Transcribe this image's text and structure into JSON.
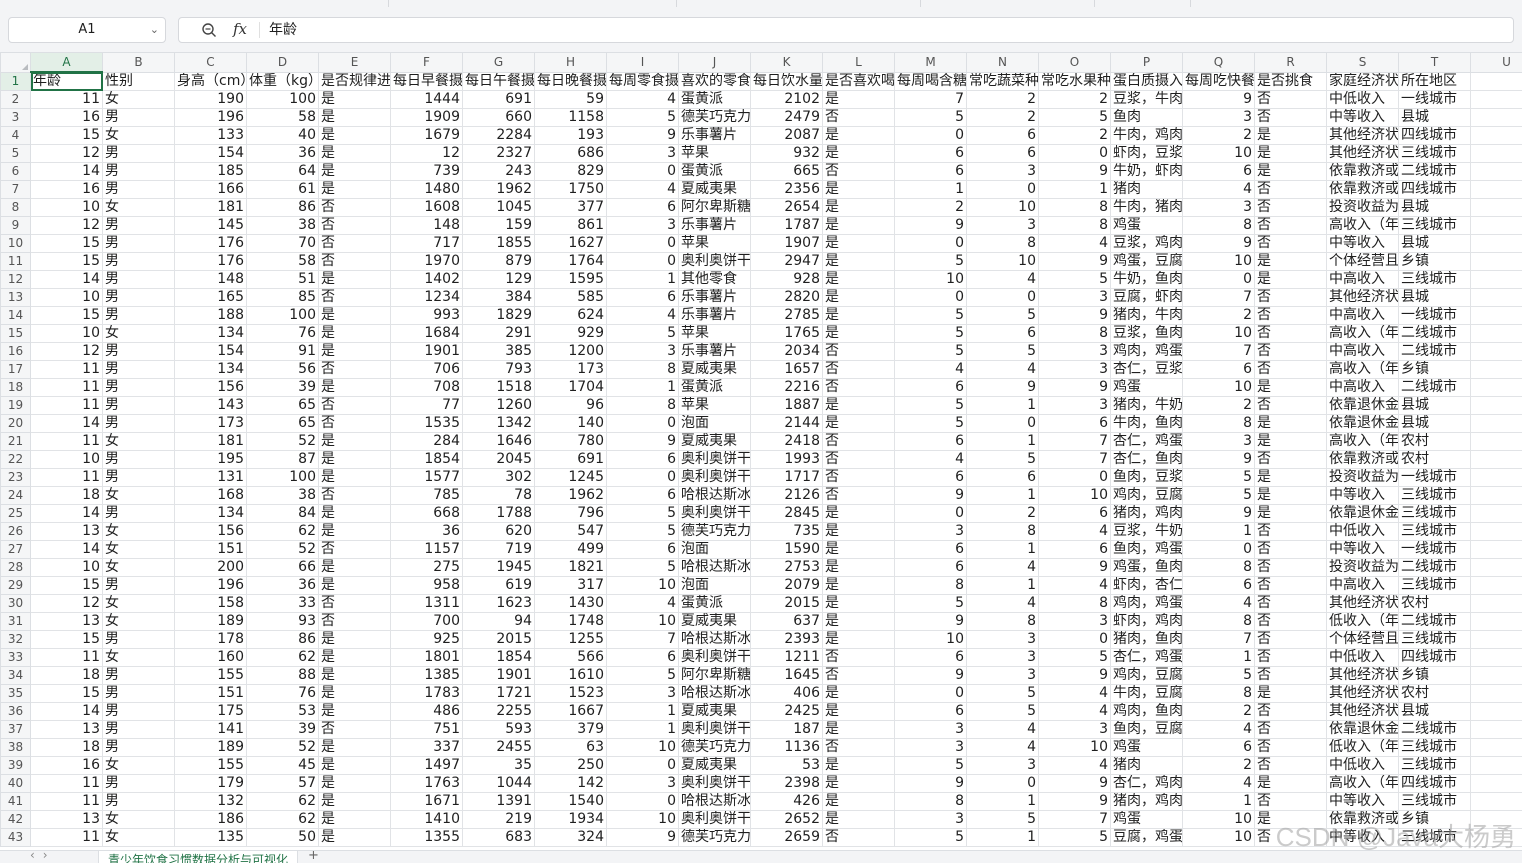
{
  "formula_bar": {
    "cell_ref": "A1",
    "value": "年龄"
  },
  "columns": [
    "A",
    "B",
    "C",
    "D",
    "E",
    "F",
    "G",
    "H",
    "I",
    "J",
    "K",
    "L",
    "M",
    "N",
    "O",
    "P",
    "Q",
    "R",
    "S",
    "T",
    "U"
  ],
  "rows": [
    [
      "年龄",
      "性别",
      "身高（cm）",
      "体重（kg）",
      "是否规律进",
      "每日早餐摄",
      "每日午餐摄",
      "每日晚餐摄",
      "每周零食摄",
      "喜欢的零食",
      "每日饮水量",
      "是否喜欢喝",
      "每周喝含糖",
      "常吃蔬菜种",
      "常吃水果种",
      "蛋白质摄入",
      "每周吃快餐",
      "是否挑食",
      "家庭经济状",
      "所在地区"
    ],
    [
      "11",
      "女",
      "190",
      "100",
      "是",
      "1444",
      "691",
      "59",
      "4",
      "蛋黄派",
      "2102",
      "是",
      "7",
      "2",
      "2",
      "豆浆，牛肉",
      "9",
      "否",
      "中低收入",
      "一线城市"
    ],
    [
      "16",
      "男",
      "196",
      "58",
      "是",
      "1909",
      "660",
      "1158",
      "5",
      "德芙巧克力",
      "2479",
      "否",
      "5",
      "2",
      "5",
      "鱼肉",
      "3",
      "否",
      "中等收入",
      "县城"
    ],
    [
      "15",
      "女",
      "133",
      "40",
      "是",
      "1679",
      "2284",
      "193",
      "9",
      "乐事薯片",
      "2087",
      "是",
      "0",
      "6",
      "2",
      "牛肉，鸡肉",
      "2",
      "是",
      "其他经济状",
      "四线城市"
    ],
    [
      "12",
      "男",
      "154",
      "36",
      "是",
      "12",
      "2327",
      "686",
      "3",
      "苹果",
      "932",
      "是",
      "6",
      "6",
      "0",
      "虾肉，豆浆",
      "10",
      "是",
      "其他经济状",
      "三线城市"
    ],
    [
      "14",
      "男",
      "185",
      "64",
      "是",
      "739",
      "243",
      "829",
      "0",
      "蛋黄派",
      "665",
      "否",
      "6",
      "3",
      "9",
      "牛奶，虾肉",
      "6",
      "是",
      "依靠救济或",
      "二线城市"
    ],
    [
      "16",
      "男",
      "166",
      "61",
      "是",
      "1480",
      "1962",
      "1750",
      "4",
      "夏威夷果",
      "2356",
      "是",
      "1",
      "0",
      "1",
      "猪肉",
      "4",
      "否",
      "依靠救济或",
      "四线城市"
    ],
    [
      "10",
      "女",
      "181",
      "86",
      "否",
      "1608",
      "1045",
      "377",
      "6",
      "阿尔卑斯糖",
      "2654",
      "是",
      "2",
      "10",
      "8",
      "牛肉，猪肉",
      "3",
      "否",
      "投资收益为",
      "县城"
    ],
    [
      "12",
      "男",
      "145",
      "38",
      "否",
      "148",
      "159",
      "861",
      "3",
      "乐事薯片",
      "1787",
      "是",
      "9",
      "3",
      "8",
      "鸡蛋",
      "8",
      "否",
      "高收入（年",
      "三线城市"
    ],
    [
      "15",
      "男",
      "176",
      "70",
      "否",
      "717",
      "1855",
      "1627",
      "0",
      "苹果",
      "1907",
      "是",
      "0",
      "8",
      "4",
      "豆浆，鸡肉",
      "9",
      "否",
      "中等收入",
      "县城"
    ],
    [
      "15",
      "男",
      "176",
      "58",
      "否",
      "1970",
      "879",
      "1764",
      "0",
      "奥利奥饼干",
      "2947",
      "是",
      "5",
      "10",
      "9",
      "鸡蛋，豆腐",
      "10",
      "是",
      "个体经营且",
      "乡镇"
    ],
    [
      "14",
      "男",
      "148",
      "51",
      "是",
      "1402",
      "129",
      "1595",
      "1",
      "其他零食",
      "928",
      "是",
      "10",
      "4",
      "5",
      "牛奶，鱼肉",
      "0",
      "是",
      "中高收入",
      "三线城市"
    ],
    [
      "10",
      "男",
      "165",
      "85",
      "否",
      "1234",
      "384",
      "585",
      "6",
      "乐事薯片",
      "2820",
      "是",
      "0",
      "0",
      "3",
      "豆腐，虾肉",
      "7",
      "否",
      "其他经济状",
      "县城"
    ],
    [
      "15",
      "男",
      "188",
      "100",
      "是",
      "993",
      "1829",
      "624",
      "4",
      "乐事薯片",
      "2785",
      "是",
      "5",
      "5",
      "9",
      "猪肉，牛肉",
      "2",
      "否",
      "中高收入",
      "一线城市"
    ],
    [
      "10",
      "女",
      "134",
      "76",
      "是",
      "1684",
      "291",
      "929",
      "5",
      "苹果",
      "1765",
      "是",
      "5",
      "6",
      "8",
      "豆浆，鱼肉",
      "10",
      "否",
      "高收入（年",
      "二线城市"
    ],
    [
      "12",
      "男",
      "154",
      "91",
      "是",
      "1901",
      "385",
      "1200",
      "3",
      "乐事薯片",
      "2034",
      "否",
      "5",
      "5",
      "3",
      "鸡肉，鸡蛋",
      "7",
      "否",
      "中高收入",
      "二线城市"
    ],
    [
      "11",
      "男",
      "134",
      "56",
      "否",
      "706",
      "793",
      "173",
      "8",
      "夏威夷果",
      "1657",
      "否",
      "4",
      "4",
      "3",
      "杏仁，豆浆",
      "6",
      "否",
      "高收入（年",
      "乡镇"
    ],
    [
      "11",
      "男",
      "156",
      "39",
      "是",
      "708",
      "1518",
      "1704",
      "1",
      "蛋黄派",
      "2216",
      "否",
      "6",
      "9",
      "9",
      "鸡蛋",
      "10",
      "是",
      "中高收入",
      "二线城市"
    ],
    [
      "11",
      "男",
      "143",
      "65",
      "否",
      "77",
      "1260",
      "96",
      "8",
      "苹果",
      "1887",
      "是",
      "5",
      "1",
      "3",
      "猪肉，牛奶",
      "2",
      "否",
      "依靠退休金",
      "县城"
    ],
    [
      "14",
      "男",
      "173",
      "65",
      "否",
      "1535",
      "1342",
      "140",
      "0",
      "泡面",
      "2144",
      "是",
      "5",
      "0",
      "6",
      "牛肉，鱼肉",
      "8",
      "是",
      "依靠退休金",
      "县城"
    ],
    [
      "11",
      "女",
      "181",
      "52",
      "是",
      "284",
      "1646",
      "780",
      "9",
      "夏威夷果",
      "2418",
      "否",
      "6",
      "1",
      "7",
      "杏仁，鸡蛋",
      "3",
      "是",
      "高收入（年",
      "农村"
    ],
    [
      "10",
      "男",
      "195",
      "87",
      "是",
      "1854",
      "2045",
      "691",
      "6",
      "奥利奥饼干",
      "1993",
      "否",
      "4",
      "5",
      "7",
      "杏仁，鱼肉",
      "9",
      "否",
      "依靠救济或",
      "农村"
    ],
    [
      "11",
      "男",
      "131",
      "100",
      "是",
      "1577",
      "302",
      "1245",
      "0",
      "奥利奥饼干",
      "1717",
      "否",
      "6",
      "6",
      "0",
      "鱼肉，豆浆",
      "5",
      "是",
      "投资收益为",
      "一线城市"
    ],
    [
      "18",
      "女",
      "168",
      "38",
      "否",
      "785",
      "78",
      "1962",
      "6",
      "哈根达斯冰",
      "2126",
      "否",
      "9",
      "1",
      "10",
      "鸡肉，豆腐",
      "5",
      "是",
      "中等收入",
      "三线城市"
    ],
    [
      "14",
      "男",
      "134",
      "84",
      "是",
      "668",
      "1788",
      "796",
      "5",
      "奥利奥饼干",
      "2845",
      "是",
      "0",
      "2",
      "6",
      "猪肉，鸡肉",
      "9",
      "是",
      "依靠退休金",
      "三线城市"
    ],
    [
      "13",
      "女",
      "156",
      "62",
      "是",
      "36",
      "620",
      "547",
      "5",
      "德芙巧克力",
      "735",
      "是",
      "3",
      "8",
      "4",
      "豆浆，牛奶",
      "1",
      "否",
      "中低收入",
      "三线城市"
    ],
    [
      "14",
      "女",
      "151",
      "52",
      "否",
      "1157",
      "719",
      "499",
      "6",
      "泡面",
      "1590",
      "是",
      "6",
      "1",
      "6",
      "鱼肉，鸡蛋",
      "0",
      "否",
      "中等收入",
      "一线城市"
    ],
    [
      "10",
      "女",
      "200",
      "66",
      "是",
      "275",
      "1945",
      "1821",
      "5",
      "哈根达斯冰",
      "2753",
      "是",
      "6",
      "4",
      "9",
      "鸡蛋，鱼肉",
      "8",
      "否",
      "投资收益为",
      "二线城市"
    ],
    [
      "15",
      "男",
      "196",
      "36",
      "是",
      "958",
      "619",
      "317",
      "10",
      "泡面",
      "2079",
      "是",
      "8",
      "1",
      "4",
      "虾肉，杏仁",
      "6",
      "否",
      "中高收入",
      "三线城市"
    ],
    [
      "12",
      "女",
      "158",
      "33",
      "否",
      "1311",
      "1623",
      "1430",
      "4",
      "蛋黄派",
      "2015",
      "是",
      "5",
      "4",
      "8",
      "鸡肉，鸡蛋",
      "4",
      "否",
      "其他经济状",
      "农村"
    ],
    [
      "13",
      "女",
      "189",
      "93",
      "否",
      "700",
      "94",
      "1748",
      "10",
      "夏威夷果",
      "637",
      "是",
      "9",
      "8",
      "3",
      "虾肉，鸡肉",
      "8",
      "否",
      "低收入（年",
      "二线城市"
    ],
    [
      "15",
      "男",
      "178",
      "86",
      "是",
      "925",
      "2015",
      "1255",
      "7",
      "哈根达斯冰",
      "2393",
      "是",
      "10",
      "3",
      "0",
      "猪肉，鱼肉",
      "7",
      "否",
      "个体经营且",
      "三线城市"
    ],
    [
      "11",
      "女",
      "160",
      "62",
      "是",
      "1801",
      "1854",
      "566",
      "6",
      "奥利奥饼干",
      "1211",
      "否",
      "6",
      "3",
      "5",
      "杏仁，鸡蛋",
      "1",
      "否",
      "中低收入",
      "四线城市"
    ],
    [
      "18",
      "男",
      "155",
      "88",
      "是",
      "1385",
      "1901",
      "1610",
      "5",
      "阿尔卑斯糖",
      "1645",
      "否",
      "9",
      "3",
      "9",
      "鸡肉，豆腐",
      "5",
      "否",
      "其他经济状",
      "乡镇"
    ],
    [
      "15",
      "男",
      "151",
      "76",
      "是",
      "1783",
      "1721",
      "1523",
      "3",
      "哈根达斯冰",
      "406",
      "是",
      "0",
      "5",
      "4",
      "牛肉，豆腐",
      "8",
      "是",
      "其他经济状",
      "农村"
    ],
    [
      "14",
      "男",
      "175",
      "53",
      "是",
      "486",
      "2255",
      "1667",
      "1",
      "夏威夷果",
      "2425",
      "是",
      "6",
      "5",
      "4",
      "鸡肉，鱼肉",
      "2",
      "否",
      "其他经济状",
      "县城"
    ],
    [
      "13",
      "男",
      "141",
      "39",
      "否",
      "751",
      "593",
      "379",
      "1",
      "奥利奥饼干",
      "187",
      "是",
      "3",
      "4",
      "3",
      "鱼肉，豆腐",
      "4",
      "否",
      "依靠退休金",
      "二线城市"
    ],
    [
      "18",
      "男",
      "189",
      "52",
      "是",
      "337",
      "2455",
      "63",
      "10",
      "德芙巧克力",
      "1136",
      "否",
      "3",
      "4",
      "10",
      "鸡蛋",
      "6",
      "否",
      "低收入（年",
      "三线城市"
    ],
    [
      "16",
      "女",
      "155",
      "45",
      "是",
      "1497",
      "35",
      "250",
      "0",
      "夏威夷果",
      "53",
      "是",
      "5",
      "3",
      "4",
      "猪肉",
      "2",
      "否",
      "中低收入",
      "三线城市"
    ],
    [
      "11",
      "男",
      "179",
      "57",
      "是",
      "1763",
      "1044",
      "142",
      "3",
      "奥利奥饼干",
      "2398",
      "是",
      "9",
      "0",
      "9",
      "杏仁，鸡肉",
      "4",
      "是",
      "高收入（年",
      "四线城市"
    ],
    [
      "11",
      "男",
      "132",
      "62",
      "是",
      "1671",
      "1391",
      "1540",
      "0",
      "哈根达斯冰",
      "426",
      "是",
      "8",
      "1",
      "9",
      "猪肉，鸡肉",
      "1",
      "否",
      "中等收入",
      "三线城市"
    ],
    [
      "13",
      "女",
      "186",
      "62",
      "是",
      "1410",
      "219",
      "1934",
      "10",
      "奥利奥饼干",
      "2652",
      "是",
      "3",
      "5",
      "7",
      "鸡蛋",
      "10",
      "是",
      "依靠救济或",
      "乡镇"
    ],
    [
      "11",
      "女",
      "135",
      "50",
      "是",
      "1355",
      "683",
      "324",
      "9",
      "德芙巧克力",
      "2659",
      "否",
      "5",
      "1",
      "5",
      "豆腐，鸡蛋",
      "10",
      "否",
      "中等收入",
      "三线城市"
    ]
  ],
  "sheet_tab": "青少年饮食习惯数据分析与可视化",
  "watermark": "CSDN @Java大杨勇"
}
